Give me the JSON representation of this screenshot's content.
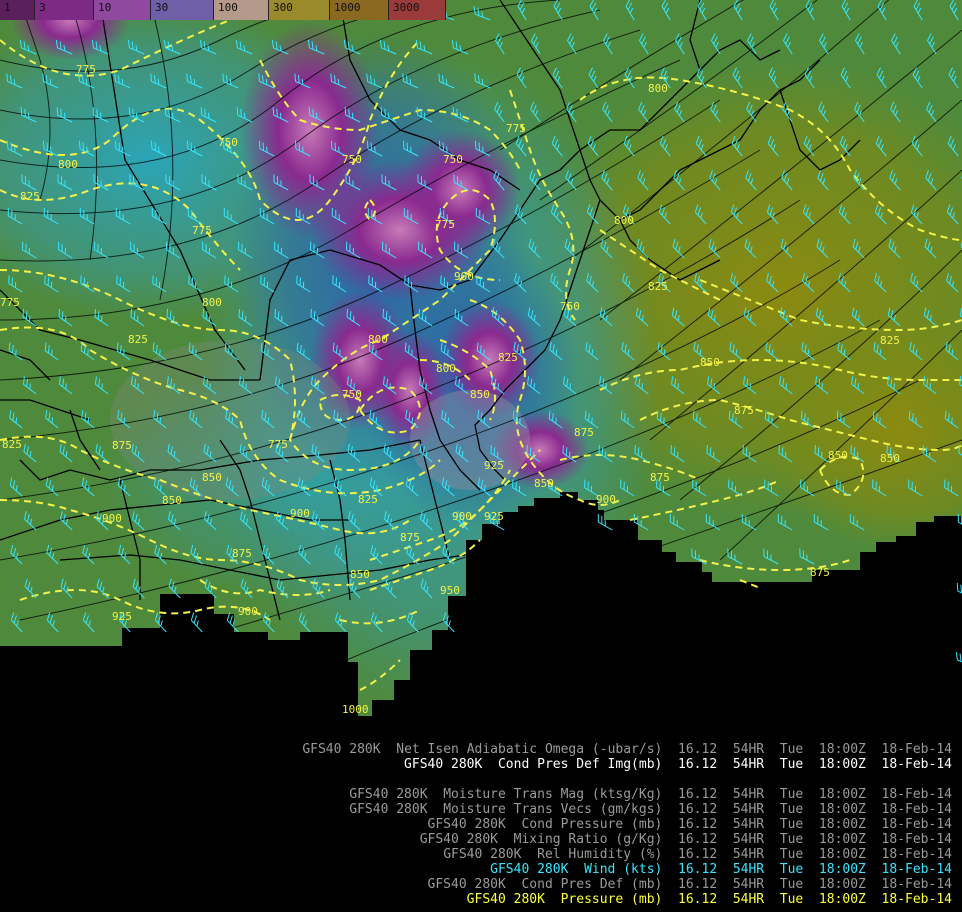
{
  "legend": {
    "ticks": [
      "1",
      "3",
      "10",
      "30",
      "100",
      "300",
      "1000",
      "3000"
    ],
    "colors": [
      "#5a1f5c",
      "#7c2a84",
      "#8f4aa0",
      "#6f5fa8",
      "#b59a8c",
      "#9a8a2c",
      "#8a6a20",
      "#9a3a3a"
    ]
  },
  "contour_labels": [
    "775",
    "750",
    "750",
    "750",
    "750",
    "775",
    "800",
    "775",
    "825",
    "800",
    "775",
    "800",
    "825",
    "825",
    "850",
    "875",
    "900",
    "900",
    "825",
    "850",
    "875",
    "900",
    "925",
    "950",
    "1000",
    "775",
    "750",
    "800",
    "850",
    "800",
    "825",
    "850",
    "875",
    "850",
    "850",
    "875",
    "875",
    "900",
    "925",
    "900",
    "875",
    "850",
    "825",
    "800",
    "775",
    "825",
    "850",
    "875",
    "900",
    "925"
  ],
  "info_lines": [
    {
      "model": "GFS40",
      "level": "280K",
      "field": "Net Isen Adiabatic Omega (-ubar/s)",
      "run": "16.12",
      "fhr": "54HR",
      "day": "Tue",
      "time": "18:00Z",
      "date": "18-Feb-14",
      "color": "gray"
    },
    {
      "model": "GFS40",
      "level": "280K",
      "field": "Cond Pres Def Img(mb)",
      "run": "16.12",
      "fhr": "54HR",
      "day": "Tue",
      "time": "18:00Z",
      "date": "18-Feb-14",
      "color": "white"
    },
    {
      "model": "GFS40",
      "level": "280K",
      "field": "Moisture Trans Mag (ktsg/Kg)",
      "run": "16.12",
      "fhr": "54HR",
      "day": "Tue",
      "time": "18:00Z",
      "date": "18-Feb-14",
      "color": "gray"
    },
    {
      "model": "GFS40",
      "level": "280K",
      "field": "Moisture Trans Vecs (gm/kgs)",
      "run": "16.12",
      "fhr": "54HR",
      "day": "Tue",
      "time": "18:00Z",
      "date": "18-Feb-14",
      "color": "gray"
    },
    {
      "model": "GFS40",
      "level": "280K",
      "field": "Cond Pressure (mb)",
      "run": "16.12",
      "fhr": "54HR",
      "day": "Tue",
      "time": "18:00Z",
      "date": "18-Feb-14",
      "color": "gray"
    },
    {
      "model": "GFS40",
      "level": "280K",
      "field": "Mixing Ratio (g/Kg)",
      "run": "16.12",
      "fhr": "54HR",
      "day": "Tue",
      "time": "18:00Z",
      "date": "18-Feb-14",
      "color": "gray"
    },
    {
      "model": "GFS40",
      "level": "280K",
      "field": "Rel Humidity (%)",
      "run": "16.12",
      "fhr": "54HR",
      "day": "Tue",
      "time": "18:00Z",
      "date": "18-Feb-14",
      "color": "gray"
    },
    {
      "model": "GFS40",
      "level": "280K",
      "field": "Wind (kts)",
      "run": "16.12",
      "fhr": "54HR",
      "day": "Tue",
      "time": "18:00Z",
      "date": "18-Feb-14",
      "color": "cyan"
    },
    {
      "model": "GFS40",
      "level": "280K",
      "field": "Cond Pres Def (mb)",
      "run": "16.12",
      "fhr": "54HR",
      "day": "Tue",
      "time": "18:00Z",
      "date": "18-Feb-14",
      "color": "gray"
    },
    {
      "model": "GFS40",
      "level": "280K",
      "field": "Pressure (mb)",
      "run": "16.12",
      "fhr": "54HR",
      "day": "Tue",
      "time": "18:00Z",
      "date": "18-Feb-14",
      "color": "yellow"
    }
  ]
}
